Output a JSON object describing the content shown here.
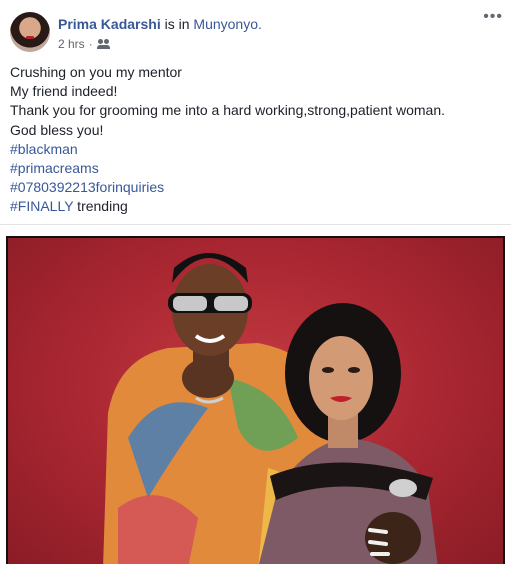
{
  "post": {
    "author": "Prima Kadarshi",
    "is_in": " is in ",
    "location": "Munyonyo.",
    "timestamp": "2 hrs",
    "separator": "·",
    "audience_icon": "friends-icon",
    "more_icon": "more-options-icon",
    "more_glyph": "•••",
    "lines": [
      "Crushing on you my mentor",
      "My friend indeed!",
      "Thank you for grooming me into a hard working,strong,patient woman.",
      "God bless you!"
    ],
    "hashtags": [
      "#blackman",
      "#primacreams",
      "#0780392213forinquiries",
      "#FINALLY"
    ],
    "final_word": " trending"
  },
  "colors": {
    "link": "#385898",
    "text": "#1d2129",
    "meta": "#606770",
    "photo_bg": "#a82631"
  }
}
